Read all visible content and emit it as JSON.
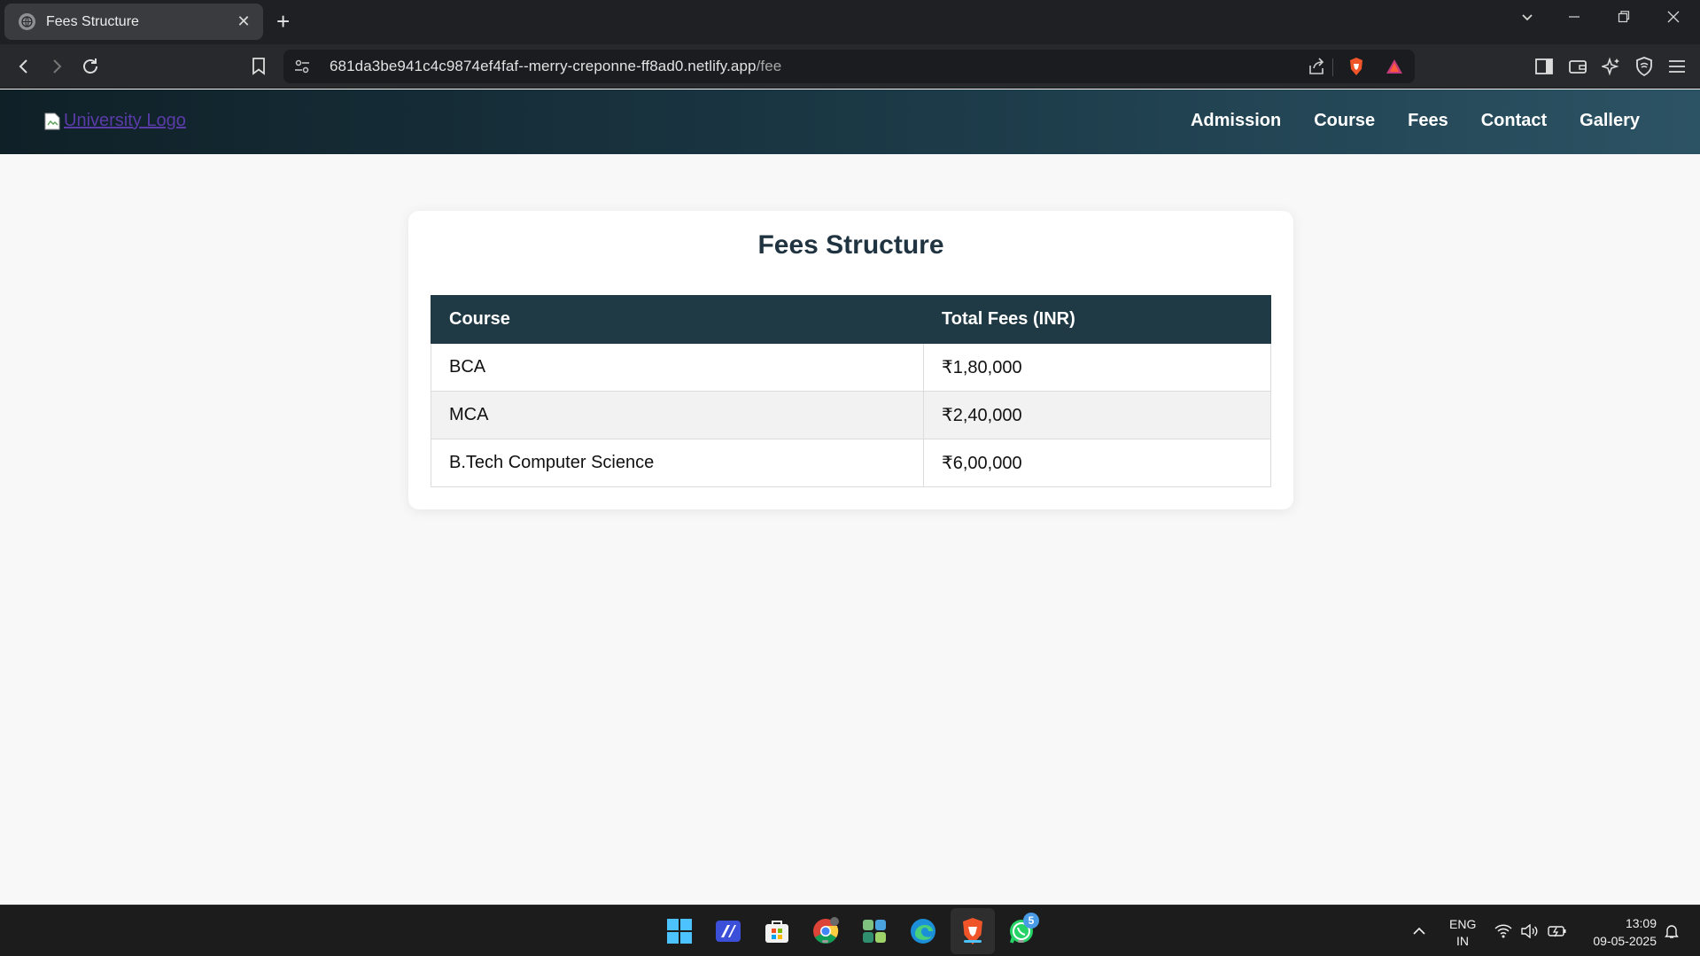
{
  "browser": {
    "tab_title": "Fees Structure",
    "tab_close": "✕",
    "new_tab": "+",
    "url_host": "681da3be941c4c9874ef4faf--merry-creponne-ff8ad0.netlify.app",
    "url_path": "/fee"
  },
  "site": {
    "logo_alt": "University Logo",
    "nav": [
      "Admission",
      "Course",
      "Fees",
      "Contact",
      "Gallery"
    ]
  },
  "page": {
    "title": "Fees Structure",
    "table": {
      "headers": [
        "Course",
        "Total Fees (INR)"
      ],
      "rows": [
        [
          "BCA",
          "₹1,80,000"
        ],
        [
          "MCA",
          "₹2,40,000"
        ],
        [
          "B.Tech Computer Science",
          "₹6,00,000"
        ]
      ]
    }
  },
  "taskbar": {
    "lang_line1": "ENG",
    "lang_line2": "IN",
    "time": "13:09",
    "date": "09-05-2025",
    "whatsapp_badge": "5"
  },
  "colors": {
    "header_start": "#0f2027",
    "header_end": "#2c5364",
    "table_header": "#203a45",
    "title": "#1f3340"
  }
}
